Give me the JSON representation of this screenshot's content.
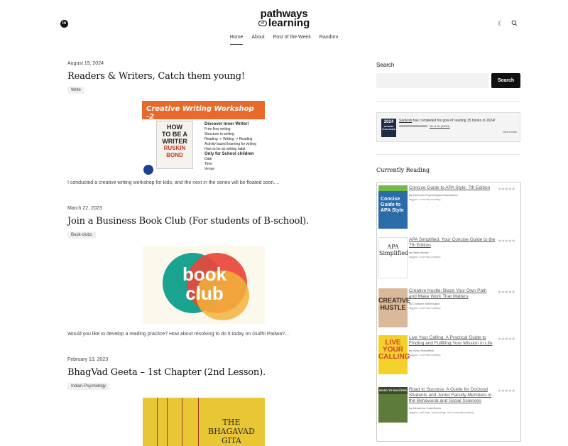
{
  "header": {
    "logo_line1": "pathways",
    "logo_of": "of",
    "logo_line2": "learning",
    "linkedin_label": "in",
    "nav": [
      "Home",
      "About",
      "Post of the Week",
      "Random"
    ],
    "active_nav": "Home"
  },
  "posts": [
    {
      "date": "August 19, 2024",
      "title": "Readers & Writers, Catch them young!",
      "tag": "Write",
      "excerpt": "I conducted a creative writing workshop for kids, and the next in the series will be floated soon....",
      "image": {
        "banner": "Creative Writing Workshop -2",
        "book_line1": "HOW",
        "book_line2": "TO BE A",
        "book_line3": "WRITER",
        "book_author": "RUSKIN BOND",
        "list": [
          "Discover Inner Writer!",
          "Free flow writing",
          "Structure to writing",
          "Reading -> Writing -> Reading",
          "Activity based learning for writing",
          "How to be an writing habit",
          "Only for School children",
          "Date",
          "Time",
          "Venue"
        ]
      }
    },
    {
      "date": "March 22, 2023",
      "title": "Join a Business Book Club (For students of B-school).",
      "tag": "Book-clubs",
      "excerpt": "Would you like to develop a reading practice? How about resolving to do it today on Gudhi Padwa?...",
      "image": {
        "line1": "book",
        "line2": "club"
      }
    },
    {
      "date": "February 13, 2023",
      "title": "BhagVad Geeta – 1st Chapter (2nd Lesson).",
      "tag": "Indian-Psychology",
      "image": {
        "line1": "THE",
        "line2": "BHAGAVAD",
        "line3": "GITA"
      }
    }
  ],
  "sidebar": {
    "search_heading": "Search",
    "search_button": "Search",
    "goodreads": {
      "cover_year": "2024",
      "cover_label": "READING CHALLENGE",
      "user": "Santosh",
      "text": " has completed his goal of reading 15 books in 2024!",
      "progress": 1.0,
      "count": "15 of 15 (100%)",
      "view": "view books"
    },
    "currently_reading_heading": "Currently Reading",
    "books": [
      {
        "title": "Concise Guide to APA Style: 7th Edition",
        "by": "by American Psychological Association",
        "shelf": "tagged: currently-reading",
        "cover_text": "Concise Guide to APA Style"
      },
      {
        "title": "APA Simplified: Your Concise Guide to the 7th Edition",
        "by": "by Mark Hanley",
        "shelf": "tagged: currently-reading",
        "cover_text": "APA Simplified"
      },
      {
        "title": "Creative Hustle: Blaze Your Own Path and Make Work That Matters",
        "by": "by Christine Stebbington",
        "shelf": "tagged: currently-reading",
        "cover_text": "CREATIVE HUSTLE"
      },
      {
        "title": "Live Your Calling: A Practical Guide to Finding and Fulfilling Your Mission in Life",
        "by": "by Kevin Brennfleck",
        "shelf": "tagged: currently-reading",
        "cover_text": "LIVE YOUR CALLING"
      },
      {
        "title": "Road to Success: A Guide for Doctoral Students and Junior Faculty Members in the Behavioral and Social Sciences",
        "by": "by Alexandra Castellanos",
        "shelf": "tagged: self-help, psychology, and currently-reading",
        "cover_text": "ROAD TO SUCCESS"
      }
    ],
    "stars": "★★★★★"
  }
}
